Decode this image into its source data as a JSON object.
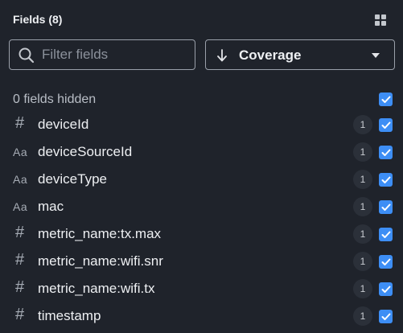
{
  "header": {
    "title": "Fields (8)",
    "layout_icon": "grid-layout-icon"
  },
  "filter": {
    "placeholder": "Filter fields",
    "value": ""
  },
  "sort": {
    "label": "Coverage",
    "direction": "descending"
  },
  "hidden": {
    "label": "0 fields hidden",
    "checked": true
  },
  "fields": [
    {
      "type": "number",
      "icon": "#",
      "name": "deviceId",
      "count": "1",
      "checked": true
    },
    {
      "type": "string",
      "icon": "Aa",
      "name": "deviceSourceId",
      "count": "1",
      "checked": true
    },
    {
      "type": "string",
      "icon": "Aa",
      "name": "deviceType",
      "count": "1",
      "checked": true
    },
    {
      "type": "string",
      "icon": "Aa",
      "name": "mac",
      "count": "1",
      "checked": true
    },
    {
      "type": "number",
      "icon": "#",
      "name": "metric_name:tx.max",
      "count": "1",
      "checked": true
    },
    {
      "type": "number",
      "icon": "#",
      "name": "metric_name:wifi.snr",
      "count": "1",
      "checked": true
    },
    {
      "type": "number",
      "icon": "#",
      "name": "metric_name:wifi.tx",
      "count": "1",
      "checked": true
    },
    {
      "type": "number",
      "icon": "#",
      "name": "timestamp",
      "count": "1",
      "checked": true
    }
  ],
  "colors": {
    "background": "#1f232b",
    "accent": "#3d8ef5",
    "badge": "#2b3039"
  }
}
